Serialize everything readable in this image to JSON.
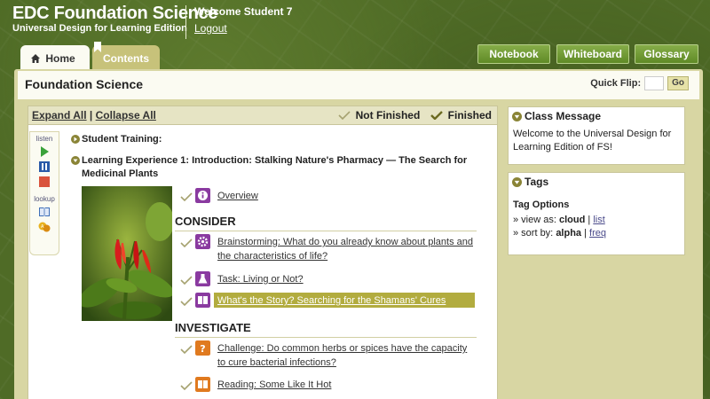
{
  "brand": {
    "title": "EDC Foundation Science",
    "subtitle": "Universal Design for Learning Edition"
  },
  "user": {
    "welcome": "Welcome Student 7",
    "logout": "Logout"
  },
  "tabs": [
    {
      "label": "Home",
      "active": true
    },
    {
      "label": "Contents",
      "active": false
    }
  ],
  "top_buttons": {
    "notebook": "Notebook",
    "whiteboard": "Whiteboard",
    "glossary": "Glossary"
  },
  "page": {
    "title": "Foundation Science",
    "quick_flip_label": "Quick Flip:",
    "quick_flip_value": "",
    "go_label": "Go"
  },
  "toolbar": {
    "expand_all": "Expand All",
    "separator": "|",
    "collapse_all": "Collapse All",
    "not_finished": "Not Finished",
    "finished": "Finished"
  },
  "side_tools": {
    "listen_label": "listen",
    "lookup_label": "lookup"
  },
  "course": {
    "items": [
      {
        "label": "Student Training:"
      },
      {
        "label": "Learning Experience 1: Introduction: Stalking Nature's Pharmacy — The Search for Medicinal Plants"
      }
    ]
  },
  "lessons": {
    "overview": "Overview",
    "section_consider": "CONSIDER",
    "brainstorming": "Brainstorming: What do you already know about plants and the characteristics of life?",
    "task": "Task: Living or Not?",
    "story": "What's the Story? Searching for the Shamans' Cures",
    "section_investigate": "INVESTIGATE",
    "challenge": "Challenge: Do common herbs or spices have the capacity to cure bacterial infections?",
    "reading": "Reading: Some Like It Hot"
  },
  "class_message": {
    "title": "Class Message",
    "body": "Welcome to the Universal Design for Learning Edition of FS!"
  },
  "tags": {
    "title": "Tags",
    "options_title": "Tag Options",
    "view_as_label": "» view as:",
    "view_cloud": "cloud",
    "view_list": "list",
    "sort_by_label": "» sort by:",
    "sort_alpha": "alpha",
    "sort_freq": "freq",
    "sep": "|"
  },
  "colors": {
    "background_green": "#4f6b26",
    "button_green": "#6f9a33",
    "frame_khaki": "#d8d6a3",
    "highlight_olive": "#b2ac3f",
    "icon_purple": "#8a3aa0",
    "icon_orange": "#e07a1f"
  },
  "icons": {
    "home": "house-icon",
    "play": "play-icon",
    "pause": "pause-icon",
    "stop": "stop-icon",
    "dictionary": "book-icon",
    "translate": "translate-icon",
    "bullet": "circle-arrow-icon",
    "check": "checkmark-icon"
  }
}
